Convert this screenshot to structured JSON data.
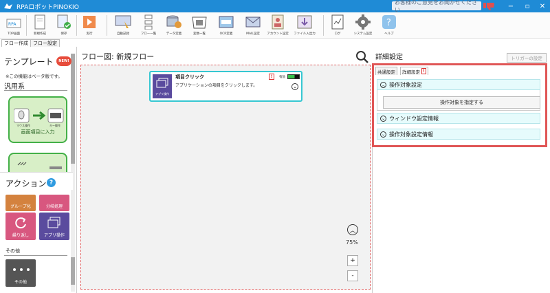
{
  "window": {
    "title": "RPAロボットPINOKIO",
    "feedback": "お客様のご意見をお聞かせください",
    "minimize": "−",
    "maximize": "▫",
    "close": "✕"
  },
  "toolbar": [
    {
      "label": "TOP画面",
      "icon": "home-icon"
    },
    {
      "label": "新規作成",
      "icon": "new-file-icon"
    },
    {
      "label": "保存",
      "icon": "save-icon"
    },
    {
      "label": "実行",
      "icon": "run-icon"
    },
    {
      "label": "自動記録",
      "icon": "record-icon"
    },
    {
      "label": "フロー一覧",
      "icon": "flow-list-icon"
    },
    {
      "label": "データ定義",
      "icon": "data-definition-icon"
    },
    {
      "label": "変数一覧",
      "icon": "variable-list-icon"
    },
    {
      "label": "OCR定義",
      "icon": "ocr-icon"
    },
    {
      "label": "MAIL設定",
      "icon": "mail-icon"
    },
    {
      "label": "アカウント設定",
      "icon": "account-icon"
    },
    {
      "label": "ファイル入出力",
      "icon": "file-io-icon"
    },
    {
      "label": "ログ",
      "icon": "log-icon"
    },
    {
      "label": "システム設定",
      "icon": "system-settings-icon"
    },
    {
      "label": "ヘルプ",
      "icon": "help-icon"
    }
  ],
  "tabs": {
    "flow_create": "フロー作成",
    "flow_settings": "フロー設定"
  },
  "left": {
    "template_title": "テンプレート",
    "new_badge": "NEW!",
    "beta_note": "※この機能はベータ版です。",
    "general": "汎用系",
    "template_card_caption": "画面項目に入力",
    "template_card_sub1": "マウス操作",
    "template_card_sub2": "キー操作",
    "action_title": "アクション",
    "actions": [
      "グループ化",
      "分岐処理",
      "繰り返し",
      "アプリ操作"
    ],
    "other_label": "その他",
    "other_action": "その他"
  },
  "canvas": {
    "flow_title": "フロー図:  新規フロー",
    "node": {
      "name": "項目クリック",
      "desc": "アプリケーションの項目をクリックします。",
      "icon_caption": "アプリ操作",
      "valid_label": "有効",
      "warn": "!"
    },
    "zoom_percent": "75%",
    "zoom_in": "+",
    "zoom_out": "-"
  },
  "detail": {
    "title": "詳細設定",
    "trigger_button": "トリガーの設定",
    "tab_common": "共通設定",
    "tab_detail": "詳細設定",
    "tab_warn": "!",
    "section_target": "操作対象設定",
    "specify_button": "操作対象を指定する",
    "section_window": "ウィンドウ設定情報",
    "section_target_info": "操作対象設定情報"
  },
  "colors": {
    "titlebar": "#1f8bd6",
    "highlight": "#e05656",
    "template_green": "#43b047",
    "action_orange": "#d4823e",
    "action_pink": "#d8577f",
    "action_purple": "#5a4b9e",
    "node_border": "#36c7d2"
  }
}
